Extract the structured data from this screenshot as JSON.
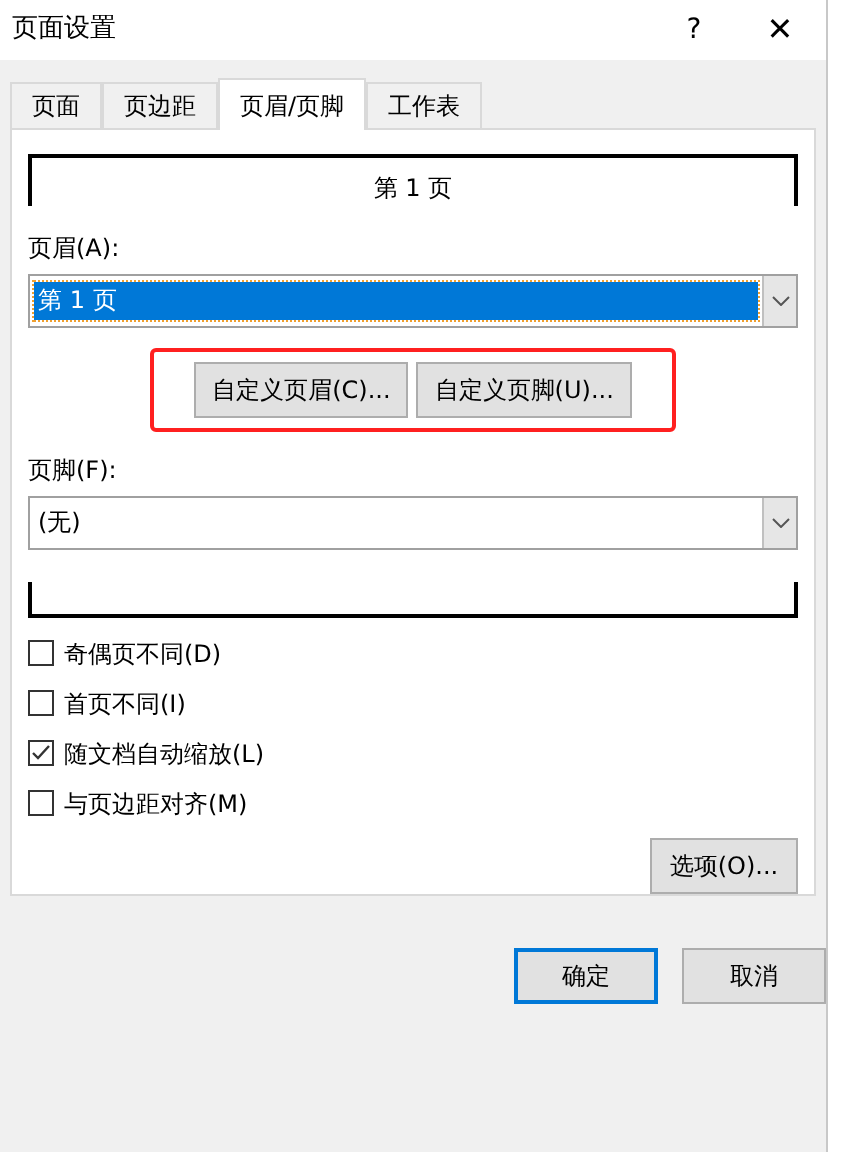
{
  "window": {
    "title": "页面设置",
    "help": "?",
    "close": "✕"
  },
  "tabs": [
    {
      "label": "页面",
      "selected": false
    },
    {
      "label": "页边距",
      "selected": false
    },
    {
      "label": "页眉/页脚",
      "selected": true
    },
    {
      "label": "工作表",
      "selected": false
    }
  ],
  "header_preview": "第 1 页",
  "header": {
    "label": "页眉(A):",
    "value": "第 1 页",
    "selected": true
  },
  "custom_buttons": {
    "highlighted": true,
    "items": [
      "自定义页眉(C)...",
      "自定义页脚(U)..."
    ]
  },
  "footer": {
    "label": "页脚(F):",
    "value": "(无)",
    "selected": false
  },
  "options": [
    {
      "label": "奇偶页不同(D)",
      "checked": false
    },
    {
      "label": "首页不同(I)",
      "checked": false
    },
    {
      "label": "随文档自动缩放(L)",
      "checked": true
    },
    {
      "label": "与页边距对齐(M)",
      "checked": false
    }
  ],
  "options_button": "选项(O)...",
  "buttons": [
    {
      "label": "确定",
      "default": true
    },
    {
      "label": "取消",
      "default": false
    }
  ]
}
